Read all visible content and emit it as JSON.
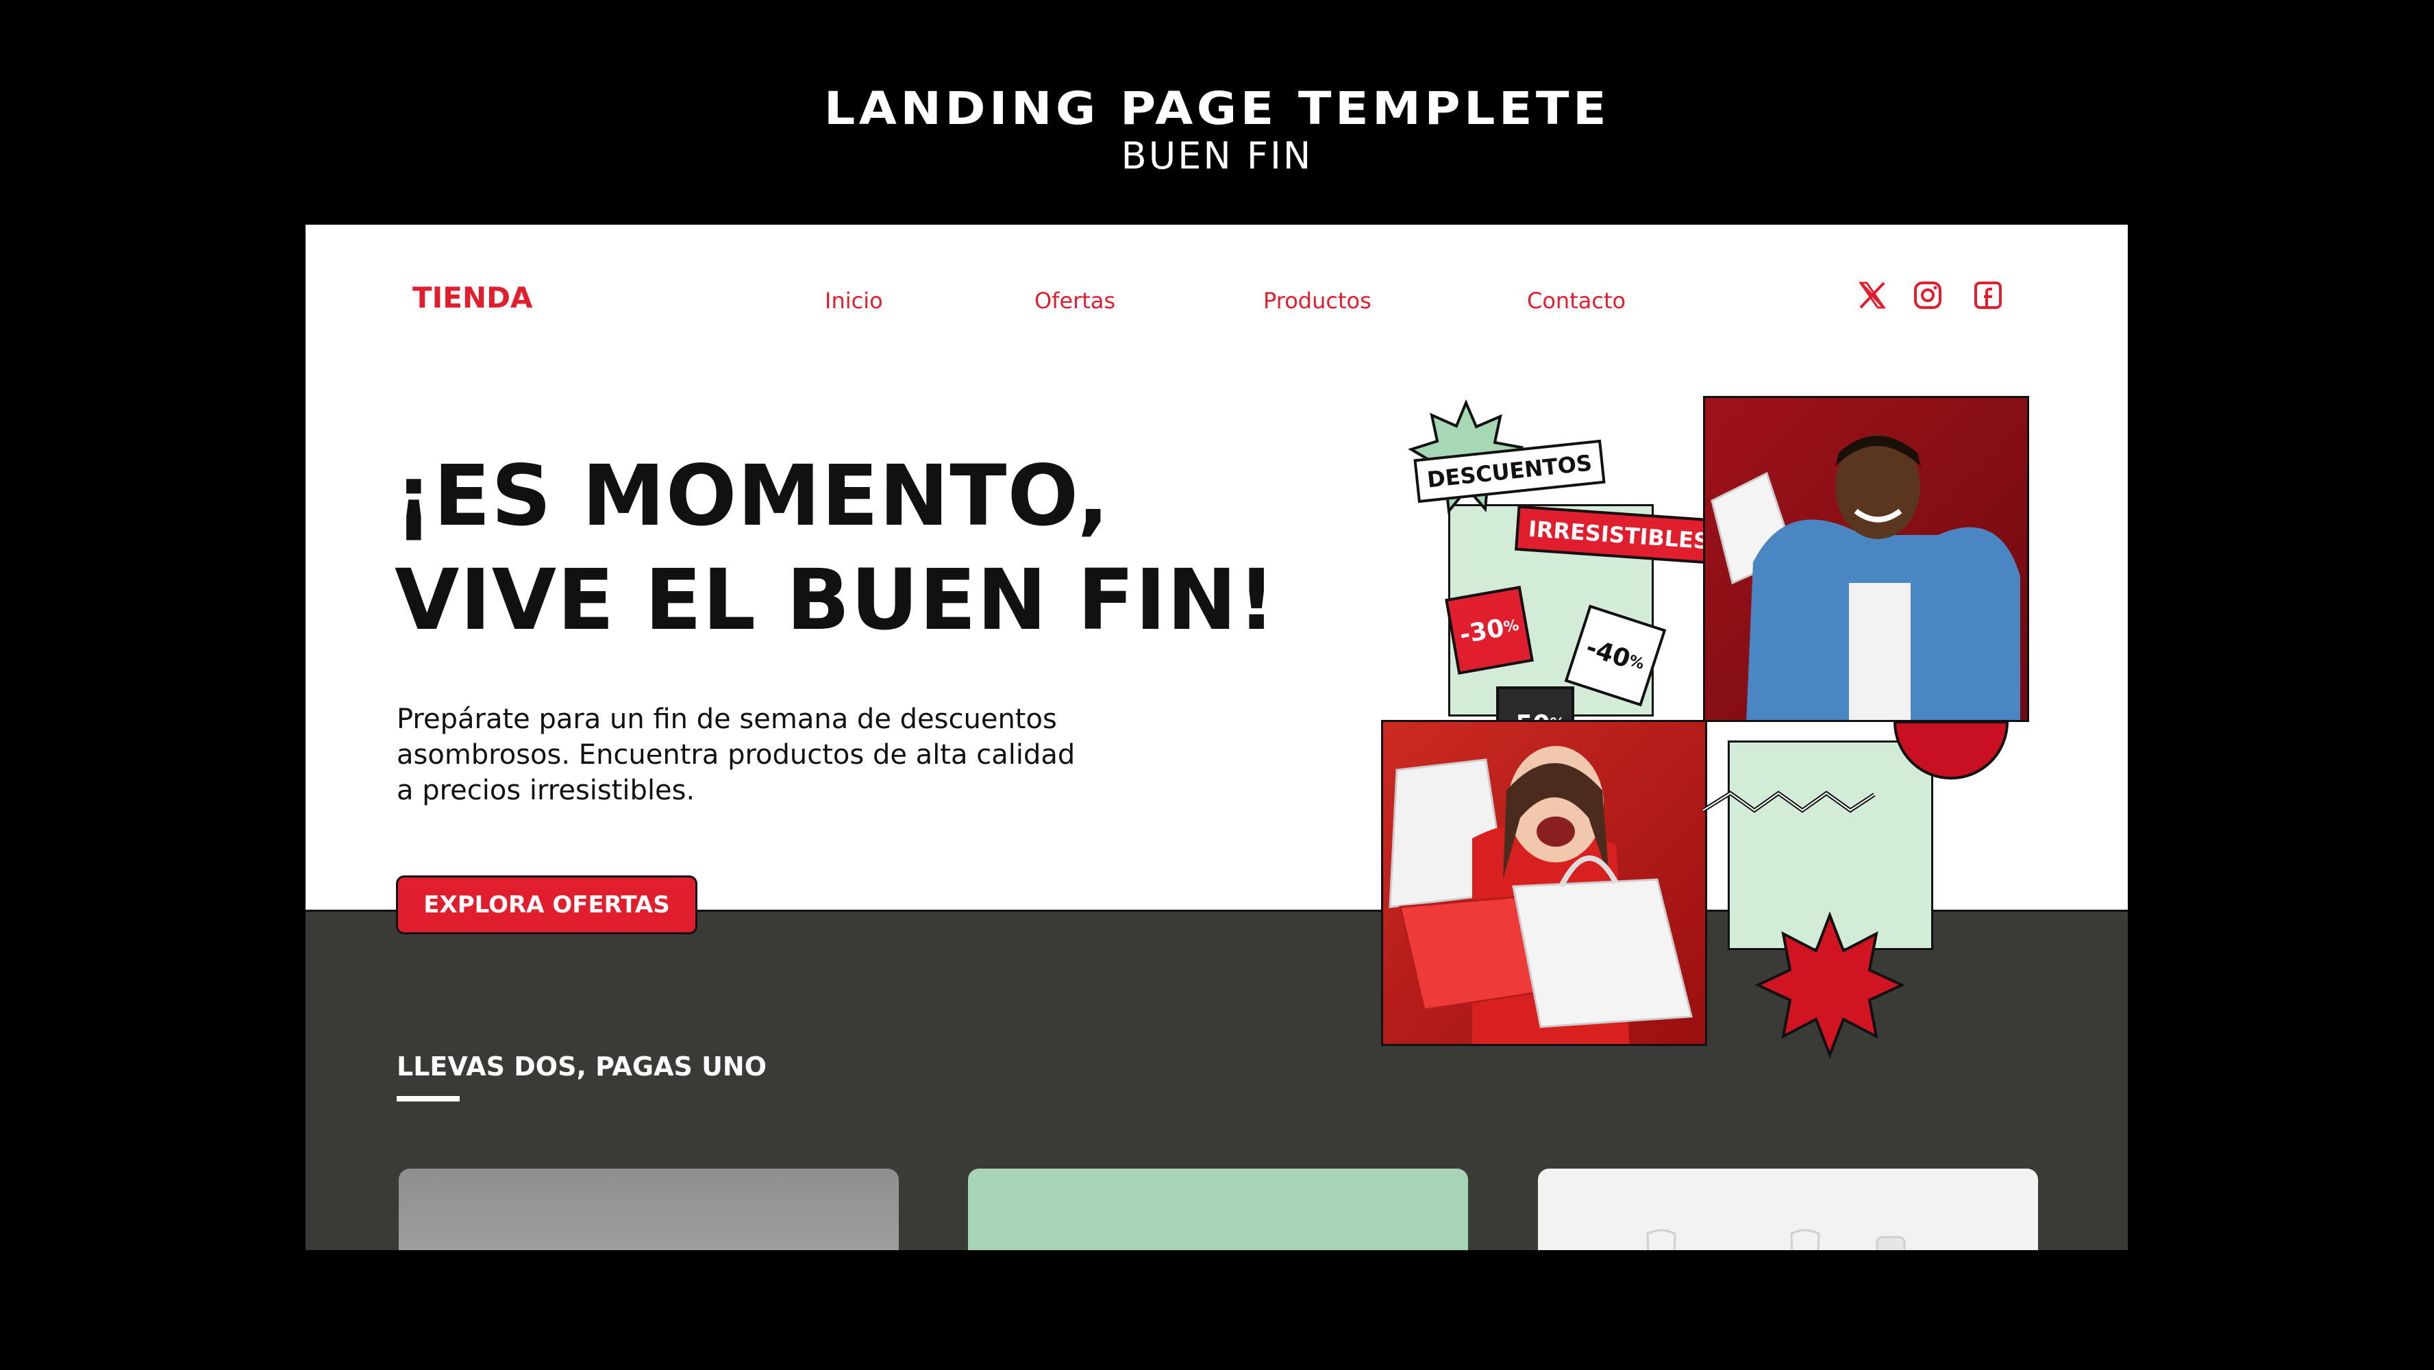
{
  "header": {
    "title": "LANDING PAGE TEMPLETE",
    "subtitle": "BUEN FIN"
  },
  "site": {
    "logo": "TIENDA",
    "nav": [
      "Inicio",
      "Ofertas",
      "Productos",
      "Contacto"
    ],
    "social_icons": [
      "x-icon",
      "instagram-icon",
      "facebook-icon"
    ],
    "accent_color": "#e01e2e",
    "dark_color": "#3a3a36",
    "mint_color": "#d3ecd8"
  },
  "hero": {
    "headline_line1": "¡ES MOMENTO,",
    "headline_line2": "VIVE EL BUEN FIN!",
    "description_line1": "Prepárate para un fin de semana de descuentos",
    "description_line2": "asombrosos. Encuentra productos de alta calidad",
    "description_line3": "a precios irresistibles.",
    "cta_label": "EXPLORA OFERTAS"
  },
  "collage": {
    "label_descuentos": "DESCUENTOS",
    "label_irresistibles": "IRRESISTIBLES",
    "tags": [
      {
        "value": "-30",
        "unit": "%"
      },
      {
        "value": "-40",
        "unit": "%"
      },
      {
        "value": "-50",
        "unit": "%"
      }
    ]
  },
  "offers": {
    "section_title": "LLEVAS DOS, PAGAS UNO"
  }
}
